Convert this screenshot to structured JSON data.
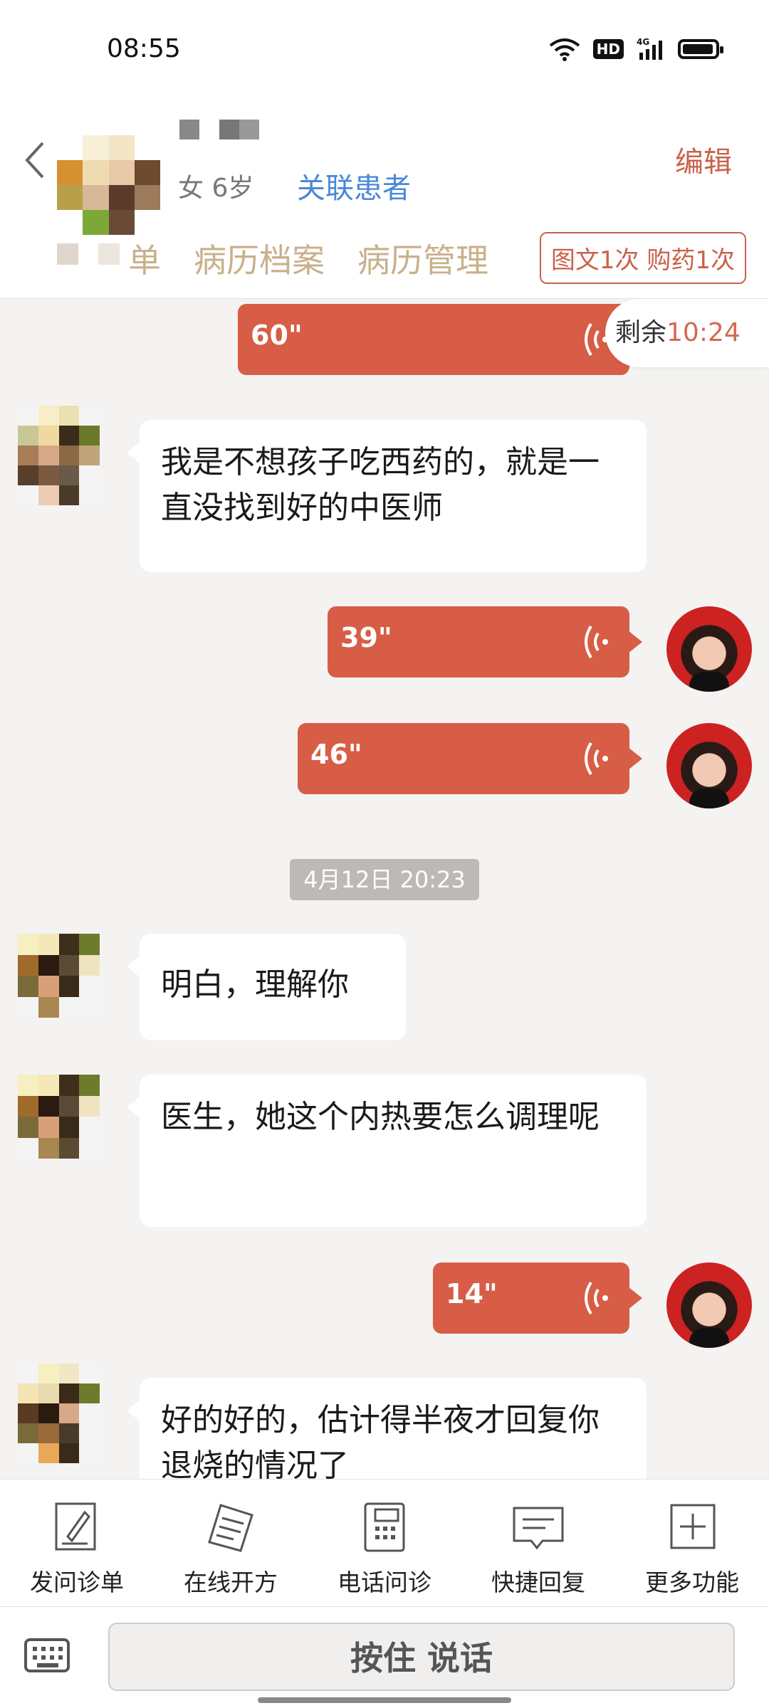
{
  "status_bar": {
    "time": "08:55",
    "hd": "HD",
    "network": "4G"
  },
  "header": {
    "meta": "女 6岁",
    "link_patient": "关联患者",
    "edit": "编辑",
    "tabs": [
      "单",
      "病历档案",
      "病历管理"
    ],
    "quota": "图文1次 购药1次"
  },
  "remaining": {
    "label": "剩余",
    "time": "10:24"
  },
  "messages": {
    "v1": "60\"",
    "m1": "我是不想孩子吃西药的，就是一直没找到好的中医师",
    "v2": "39\"",
    "v3": "46\"",
    "timestamp": "4月12日 20:23",
    "m2": "明白，理解你",
    "m3": "医生，她这个内热要怎么调理呢",
    "v4": "14\"",
    "m4": "好的好的，估计得半夜才回复你退烧的情况了"
  },
  "toolbar": [
    "发问诊单",
    "在线开方",
    "电话问诊",
    "快捷回复",
    "更多功能"
  ],
  "input": {
    "talk_label": "按住 说话"
  }
}
